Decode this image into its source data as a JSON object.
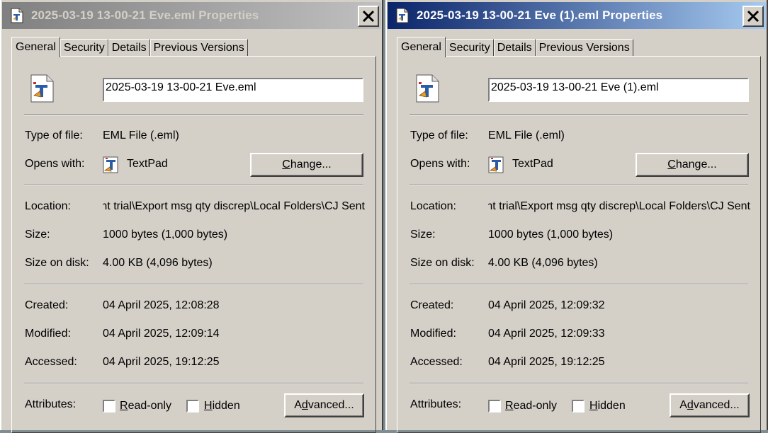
{
  "dialogs": [
    {
      "title": "2025-03-19 13-00-21 Eve.eml Properties",
      "active": false,
      "tabs": [
        "General",
        "Security",
        "Details",
        "Previous Versions"
      ],
      "filename": "2025-03-19 13-00-21 Eve.eml",
      "type_label": "Type of file:",
      "type_value": "EML File (.eml)",
      "opens_label": "Opens with:",
      "opens_app": "TextPad",
      "change_pre": "",
      "change_u": "C",
      "change_post": "hange...",
      "location_label": "Location:",
      "location_value": "ent trial\\Export msg qty discrep\\Local Folders\\CJ Sent",
      "size_label": "Size:",
      "size_value": "1000 bytes (1,000 bytes)",
      "disk_label": "Size on disk:",
      "disk_value": "4.00 KB (4,096 bytes)",
      "created_label": "Created:",
      "created_value": "04 April 2025, 12:08:28",
      "modified_label": "Modified:",
      "modified_value": "04 April 2025, 12:09:14",
      "accessed_label": "Accessed:",
      "accessed_value": "04 April 2025, 19:12:25",
      "attributes_label": "Attributes:",
      "readonly_u": "R",
      "readonly_rest": "ead-only",
      "hidden_u": "H",
      "hidden_rest": "idden",
      "advanced_pre": "A",
      "advanced_u": "d",
      "advanced_post": "vanced..."
    },
    {
      "title": "2025-03-19 13-00-21 Eve (1).eml Properties",
      "active": true,
      "tabs": [
        "General",
        "Security",
        "Details",
        "Previous Versions"
      ],
      "filename": "2025-03-19 13-00-21 Eve (1).eml",
      "type_label": "Type of file:",
      "type_value": "EML File (.eml)",
      "opens_label": "Opens with:",
      "opens_app": "TextPad",
      "change_pre": "",
      "change_u": "C",
      "change_post": "hange...",
      "location_label": "Location:",
      "location_value": "ent trial\\Export msg qty discrep\\Local Folders\\CJ Sent",
      "size_label": "Size:",
      "size_value": "1000 bytes (1,000 bytes)",
      "disk_label": "Size on disk:",
      "disk_value": "4.00 KB (4,096 bytes)",
      "created_label": "Created:",
      "created_value": "04 April 2025, 12:09:32",
      "modified_label": "Modified:",
      "modified_value": "04 April 2025, 12:09:33",
      "accessed_label": "Accessed:",
      "accessed_value": "04 April 2025, 19:12:25",
      "attributes_label": "Attributes:",
      "readonly_u": "R",
      "readonly_rest": "ead-only",
      "hidden_u": "H",
      "hidden_rest": "idden",
      "advanced_pre": "A",
      "advanced_u": "d",
      "advanced_post": "vanced..."
    }
  ],
  "icons": {
    "title": "eml-file-icon",
    "file": "eml-file-icon",
    "app": "textpad-icon",
    "close": "close-icon"
  }
}
